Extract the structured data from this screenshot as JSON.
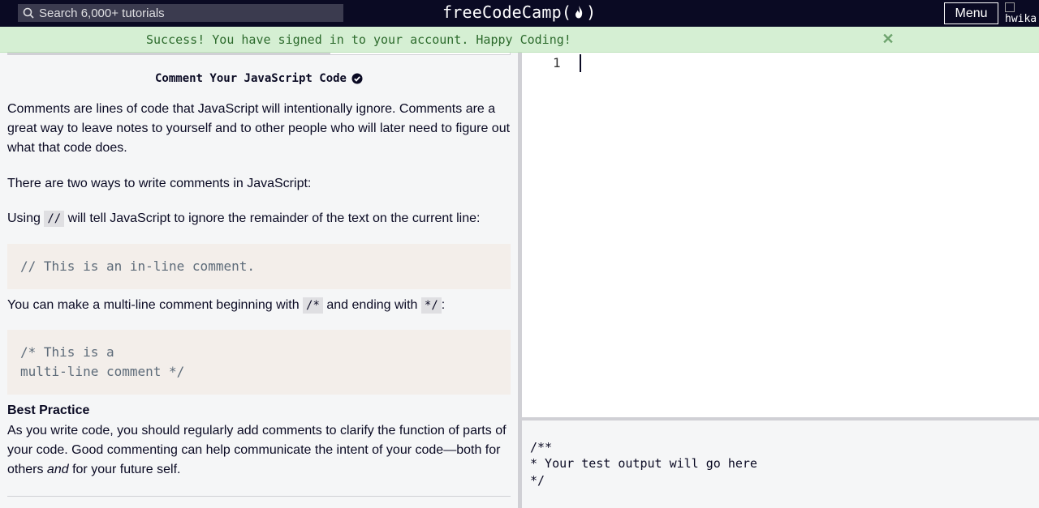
{
  "navbar": {
    "search_placeholder": "Search 6,000+ tutorials",
    "brand_left": "freeCodeCamp(",
    "brand_right": ")",
    "menu_label": "Menu",
    "avatar_alt": "hwika"
  },
  "flash": {
    "message": "Success! You have signed in to your account. Happy Coding!",
    "close_glyph": "✕"
  },
  "challenge": {
    "title": "Comment Your JavaScript Code",
    "p1": "Comments are lines of code that JavaScript will intentionally ignore. Comments are a great way to leave notes to yourself and to other people who will later need to figure out what that code does.",
    "p2": "There are two ways to write comments in JavaScript:",
    "p3_before": "Using ",
    "p3_code": "//",
    "p3_after": " will tell JavaScript to ignore the remainder of the text on the current line:",
    "code1": "// This is an in-line comment.",
    "p4_before": "You can make a multi-line comment beginning with ",
    "p4_code1": "/*",
    "p4_mid": " and ending with ",
    "p4_code2": "*/",
    "p4_after": ":",
    "code2_line1": "/* This is a",
    "code2_line2": "multi-line comment */",
    "best_practice_heading": "Best Practice",
    "p5_before": "As you write code, you should regularly add comments to clarify the function of parts of your code. Good commenting can help communicate the intent of your code—both for others ",
    "p5_em": "and",
    "p5_after": " for your future self."
  },
  "editor": {
    "line_number": "1"
  },
  "output": {
    "line1": "/**",
    "line2": "* Your test output will go here",
    "line3": "*/"
  },
  "colors": {
    "navbar_bg": "#0a0a23",
    "flash_bg": "#d5efd3",
    "flash_text": "#2d6b2d",
    "code_block_bg": "#f3eeea"
  }
}
